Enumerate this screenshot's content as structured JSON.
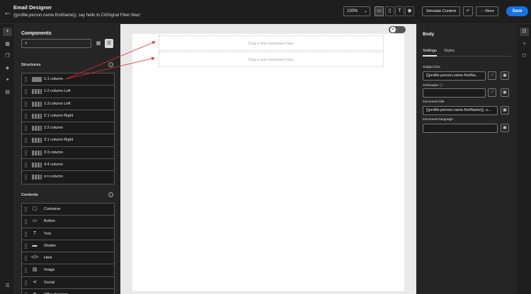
{
  "header": {
    "back_icon": "arrow-left-icon",
    "title": "Email Designer",
    "subtitle": "{{profile.person.name.firstName}}, say hello to CitiSignal Fiber Max!",
    "zoom": "100%",
    "view_icons": [
      "desktop-icon",
      "mobile-icon",
      "text-icon",
      "eye-icon"
    ],
    "simulate_label": "Simulate Content",
    "more_label": "More",
    "save_label": "Save"
  },
  "left_rail": {
    "icons": [
      "plus-icon",
      "grid-icon",
      "fragments-icon",
      "layers-icon",
      "link-icon",
      "assets-icon",
      "settings-icon"
    ]
  },
  "components": {
    "title": "Components",
    "search_placeholder": "",
    "structures_title": "Structures",
    "structures": [
      {
        "label": "1:1 column",
        "segments": 1
      },
      {
        "label": "1:2 column Left",
        "segments": 2
      },
      {
        "label": "1:3 column Left",
        "segments": 2
      },
      {
        "label": "2:1 column Right",
        "segments": 2
      },
      {
        "label": "2:2 column",
        "segments": 2
      },
      {
        "label": "3:1 column Right",
        "segments": 2
      },
      {
        "label": "3:3 column",
        "segments": 3
      },
      {
        "label": "4:4 column",
        "segments": 4
      },
      {
        "label": "n:n column",
        "segments": 3
      }
    ],
    "contents_title": "Contents",
    "contents": [
      {
        "label": "Container",
        "icon": "container-icon",
        "glyph": "▢"
      },
      {
        "label": "Button",
        "icon": "button-icon",
        "glyph": "▭"
      },
      {
        "label": "Text",
        "icon": "text-icon",
        "glyph": "T"
      },
      {
        "label": "Divider",
        "icon": "divider-icon",
        "glyph": "▬"
      },
      {
        "label": "Html",
        "icon": "code-icon",
        "glyph": "</>"
      },
      {
        "label": "Image",
        "icon": "image-icon",
        "glyph": "▨"
      },
      {
        "label": "Social",
        "icon": "share-icon",
        "glyph": "⋖"
      },
      {
        "label": "Offer decision",
        "icon": "offer-icon",
        "glyph": "◈"
      }
    ]
  },
  "canvas": {
    "dropzone_text_1": "Drag a new component here.",
    "dropzone_text_2": "Drag a new component here."
  },
  "properties": {
    "title": "Body",
    "tab_settings": "Settings",
    "tab_styles": "Styles",
    "subject_label": "Subject line",
    "subject_value": "{{profile.person.name.firstNa...",
    "preheader_label": "Preheader",
    "preheader_value": "",
    "doc_title_label": "Document title",
    "doc_title_value": "{{profile.person.name.firstName}}, s...",
    "doc_lang_label": "Document language",
    "doc_lang_value": ""
  },
  "colors": {
    "accent": "#1473e6",
    "arrow": "#d9302c"
  }
}
